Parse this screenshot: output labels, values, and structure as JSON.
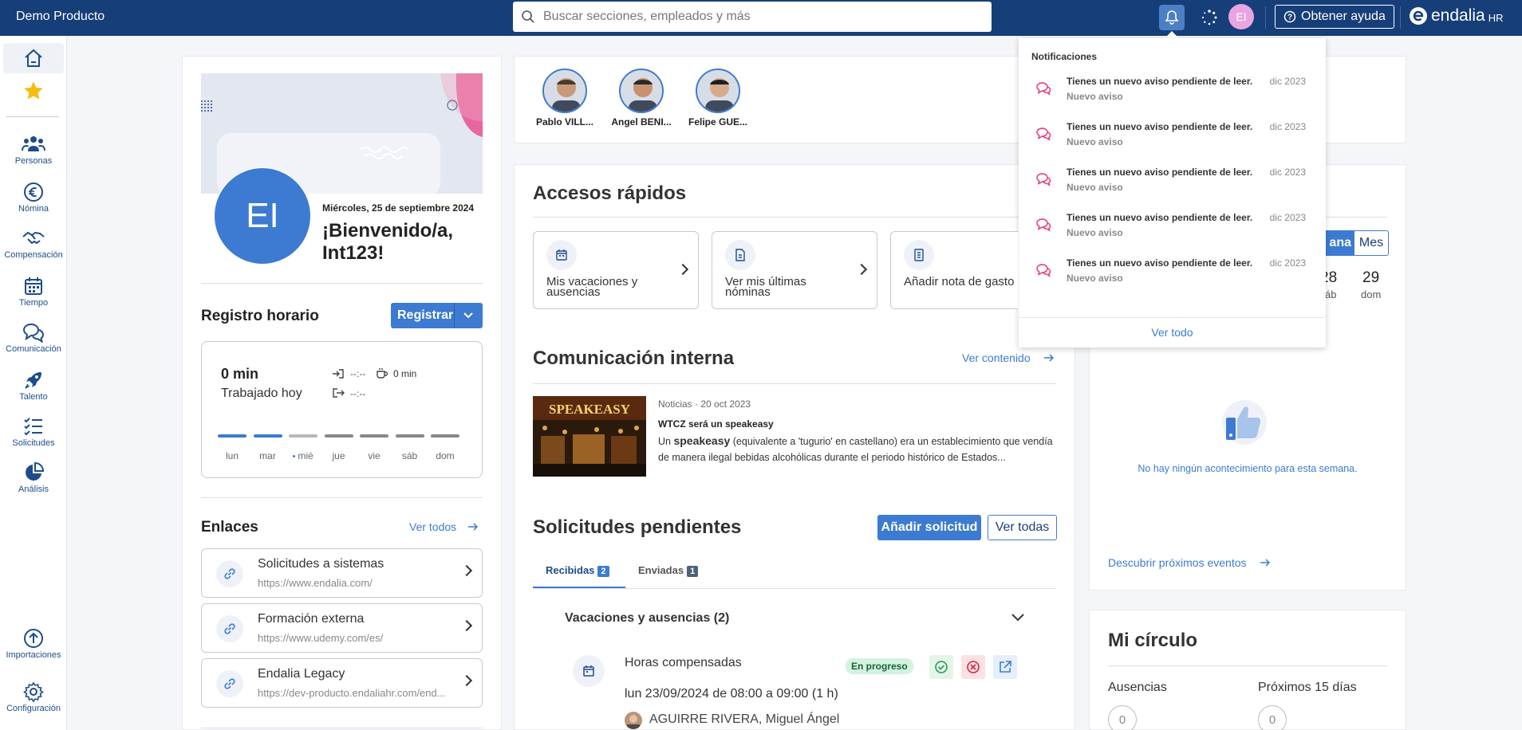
{
  "header": {
    "brand": "Demo Producto",
    "search_placeholder": "Buscar secciones, empleados y más",
    "avatar_initials": "EI",
    "help_label": "Obtener ayuda",
    "logo_text": "endalia",
    "logo_suffix": "HR"
  },
  "sidebar": {
    "items": [
      {
        "label": "Personas",
        "icon": "people-icon"
      },
      {
        "label": "Nómina",
        "icon": "euro-icon"
      },
      {
        "label": "Compensación",
        "icon": "handshake-icon"
      },
      {
        "label": "Tiempo",
        "icon": "calendar-icon"
      },
      {
        "label": "Comunicación",
        "icon": "chat-icon"
      },
      {
        "label": "Talento",
        "icon": "rocket-icon"
      },
      {
        "label": "Solicitudes",
        "icon": "checklist-icon"
      },
      {
        "label": "Análisis",
        "icon": "pie-chart-icon"
      }
    ],
    "bottom_items": [
      {
        "label": "Importaciones",
        "icon": "upload-icon"
      },
      {
        "label": "Configuración",
        "icon": "gear-icon"
      }
    ]
  },
  "profile": {
    "initials": "EI",
    "date": "Miércoles, 25 de septiembre 2024",
    "welcome": "¡Bienvenido/a, Int123!"
  },
  "clock": {
    "title": "Registro horario",
    "register_label": "Registrar",
    "worked_value": "0 min",
    "worked_label": "Trabajado hoy",
    "in_time": "--:--",
    "break_time": "0 min",
    "out_time": "--:--",
    "days": [
      "lun",
      "mar",
      "mié",
      "jue",
      "vie",
      "sáb",
      "dom"
    ],
    "today_index": 2
  },
  "links": {
    "title": "Enlaces",
    "see_all": "Ver todos",
    "items": [
      {
        "title": "Solicitudes a sistemas",
        "url": "https://www.endalia.com/"
      },
      {
        "title": "Formación externa",
        "url": "https://www.udemy.com/es/"
      },
      {
        "title": "Endalia Legacy",
        "url": "https://dev-producto.endaliahr.com/end..."
      }
    ]
  },
  "people": [
    {
      "name": "Pablo VILL..."
    },
    {
      "name": "Angel BENI..."
    },
    {
      "name": "Felipe GUE..."
    }
  ],
  "quick_access": {
    "title": "Accesos rápidos",
    "items": [
      {
        "label": "Mis vacaciones y ausencias"
      },
      {
        "label": "Ver mis últimas nóminas"
      },
      {
        "label": "Añadir nota de gasto"
      }
    ]
  },
  "internal_comm": {
    "title": "Comunicación interna",
    "see_content": "Ver contenido",
    "meta": "Noticias · 20 oct 2023",
    "headline": "WTCZ será un speakeasy",
    "body_pre": "Un ",
    "body_bold": "speakeasy",
    "body_post": " (equivalente a 'tugurio' en castellano) era un establecimiento que vendía de manera ilegal bebidas alcohólicas durante el periodo histórico de Estados...",
    "image_text": "SPEAKEASY"
  },
  "requests": {
    "title": "Solicitudes pendientes",
    "add_label": "Añadir solicitud",
    "see_all": "Ver todas",
    "tab_received": "Recibidas",
    "tab_received_count": "2",
    "tab_sent": "Enviadas",
    "tab_sent_count": "1",
    "group_title": "Vacaciones y ausencias (2)",
    "item_title": "Horas compensadas",
    "item_status": "En progreso",
    "item_when": "lun 23/09/2024 de 08:00 a 09:00 (1 h)",
    "item_person": "AGUIRRE RIVERA, Miguel Ángel"
  },
  "calendar": {
    "view_week": "ana",
    "view_month": "Mes",
    "day1_num": "28",
    "day1_label": "áb",
    "day2_num": "29",
    "day2_label": "dom",
    "empty_text": "No hay ningún acontecimiento para esta semana.",
    "discover": "Descubrir próximos eventos"
  },
  "circle": {
    "title": "Mi círculo",
    "absences_label": "Ausencias",
    "absences_value": "0",
    "next15_label": "Próximos 15 días",
    "next15_value": "0"
  },
  "notifications": {
    "title": "Notificaciones",
    "items": [
      {
        "text": "Tienes un nuevo aviso pendiente de leer.",
        "sub": "Nuevo aviso",
        "date": "dic 2023"
      },
      {
        "text": "Tienes un nuevo aviso pendiente de leer.",
        "sub": "Nuevo aviso",
        "date": "dic 2023"
      },
      {
        "text": "Tienes un nuevo aviso pendiente de leer.",
        "sub": "Nuevo aviso",
        "date": "dic 2023"
      },
      {
        "text": "Tienes un nuevo aviso pendiente de leer.",
        "sub": "Nuevo aviso",
        "date": "dic 2023"
      },
      {
        "text": "Tienes un nuevo aviso pendiente de leer.",
        "sub": "Nuevo aviso",
        "date": "dic 2023"
      }
    ],
    "see_all": "Ver todo"
  },
  "colors": {
    "topbar": "#163e79",
    "primary": "#3c7bd1",
    "accent_pink": "#e6317a",
    "status_green": "#d3f2df"
  }
}
